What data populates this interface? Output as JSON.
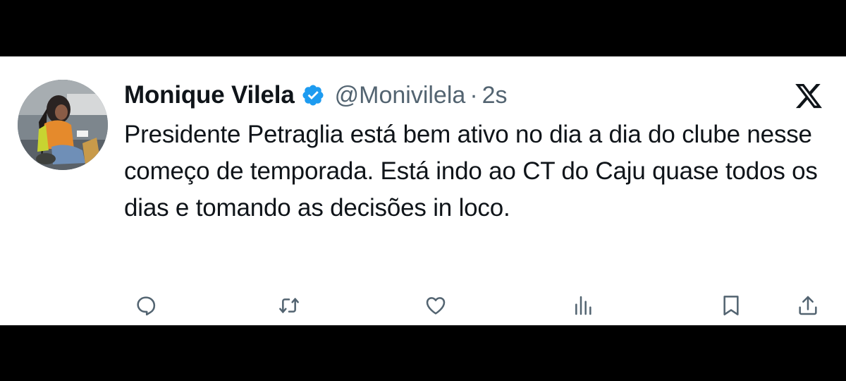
{
  "tweet": {
    "author": {
      "display_name": "Monique Vilela",
      "handle": "@Monivilela",
      "verified": true
    },
    "time_separator": "·",
    "timestamp": "2s",
    "text": "Presidente Petraglia está bem ativo no dia a dia do clube nesse começo de temporada. Está indo ao CT do Caju quase todos os dias e tomando as decisões in loco."
  },
  "icons": {
    "verified": "verified-badge-icon",
    "brand": "x-logo-icon",
    "actions": [
      "reply-icon",
      "retweet-icon",
      "like-icon",
      "views-icon",
      "bookmark-icon",
      "share-icon"
    ]
  },
  "colors": {
    "text_primary": "#0f1419",
    "text_secondary": "#536471",
    "verified_blue": "#1d9bf0",
    "background": "#ffffff",
    "letterbox": "#000000"
  }
}
